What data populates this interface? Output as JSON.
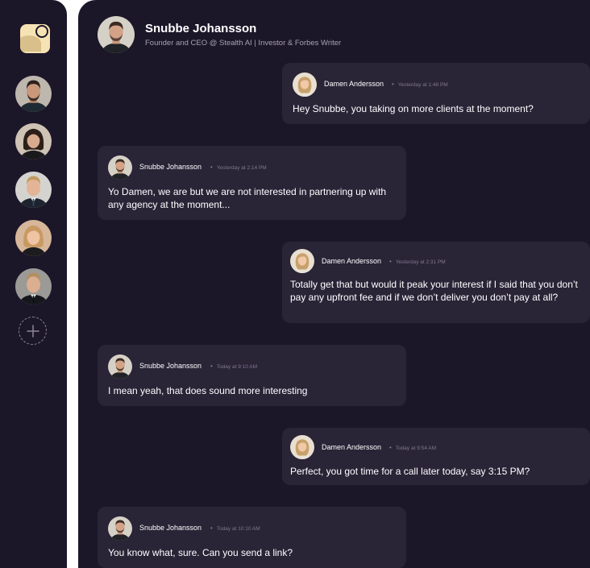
{
  "colors": {
    "background": "#1c1629",
    "bubble": "#2a2437",
    "logo": "#f6e3b3",
    "muted_text": "#a7a1b4"
  },
  "sidebar": {
    "logo_icon": "app-logo-icon",
    "contacts": [
      {
        "name": "contact-1",
        "icon": "avatar-man-beard"
      },
      {
        "name": "contact-2",
        "icon": "avatar-woman-dark-hair"
      },
      {
        "name": "contact-3",
        "icon": "avatar-man-suit-blond"
      },
      {
        "name": "contact-4",
        "icon": "avatar-woman-blonde"
      },
      {
        "name": "contact-5",
        "icon": "avatar-man-suit"
      }
    ],
    "add_icon": "plus-icon"
  },
  "header": {
    "name": "Snubbe Johansson",
    "subtitle": "Founder and CEO @ Stealth AI | Investor & Forbes Writer"
  },
  "messages": [
    {
      "sender": "Damen Andersson",
      "time": "Yesterday at 1:48 PM",
      "text": "Hey Snubbe, you taking on more clients at the moment?"
    },
    {
      "sender": "Snubbe Johansson",
      "time": "Yesterday at 2:14 PM",
      "text": "Yo Damen, we are but we are not interested in partnering up with any agency at the moment..."
    },
    {
      "sender": "Damen Andersson",
      "time": "Yesterday at 2:31 PM",
      "text": "Totally get that but would it peak your interest if I said that you don’t pay any upfront fee and if we don’t deliver you don’t pay at all?"
    },
    {
      "sender": "Snubbe Johansson",
      "time": "Today at 9:10 AM",
      "text": "I mean yeah, that does sound more interesting"
    },
    {
      "sender": "Damen Andersson",
      "time": "Today at 9:54 AM",
      "text": "Perfect, you got time for a call later today, say 3:15 PM?"
    },
    {
      "sender": "Snubbe Johansson",
      "time": "Today at 10:10 AM",
      "text": "You know what, sure. Can you send a link?"
    }
  ]
}
